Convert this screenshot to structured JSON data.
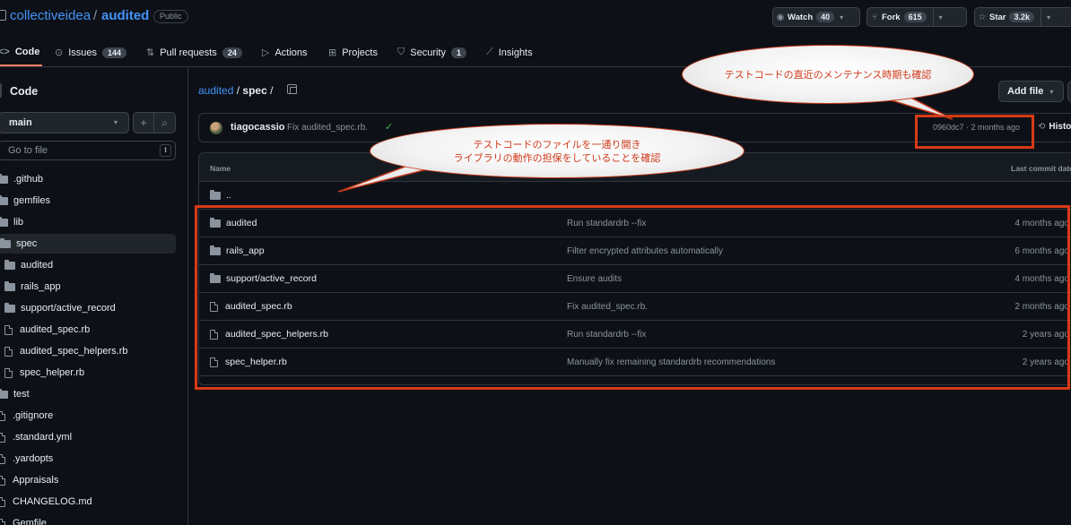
{
  "repo": {
    "owner": "collectiveidea",
    "sep": "/",
    "name": "audited",
    "visibility": "Public"
  },
  "header_buttons": {
    "watch": {
      "label": "Watch",
      "count": "40"
    },
    "fork": {
      "label": "Fork",
      "count": "615"
    },
    "star": {
      "label": "Star",
      "count": "3.2k"
    }
  },
  "tabs": [
    {
      "label": "Code"
    },
    {
      "label": "Issues",
      "count": "144"
    },
    {
      "label": "Pull requests",
      "count": "24"
    },
    {
      "label": "Actions"
    },
    {
      "label": "Projects"
    },
    {
      "label": "Security",
      "count": "1"
    },
    {
      "label": "Insights"
    }
  ],
  "sidebar": {
    "title": "Code",
    "branch": "main",
    "goto_placeholder": "Go to file",
    "goto_key": "t",
    "tree": [
      {
        "label": ".github",
        "type": "folder"
      },
      {
        "label": "gemfiles",
        "type": "folder"
      },
      {
        "label": "lib",
        "type": "folder"
      },
      {
        "label": "spec",
        "type": "folder-open"
      },
      {
        "label": "audited",
        "type": "folder"
      },
      {
        "label": "rails_app",
        "type": "folder"
      },
      {
        "label": "support/active_record",
        "type": "folder"
      },
      {
        "label": "audited_spec.rb",
        "type": "file"
      },
      {
        "label": "audited_spec_helpers.rb",
        "type": "file"
      },
      {
        "label": "spec_helper.rb",
        "type": "file"
      },
      {
        "label": "test",
        "type": "folder"
      },
      {
        "label": ".gitignore",
        "type": "file"
      },
      {
        "label": ".standard.yml",
        "type": "file"
      },
      {
        "label": ".yardopts",
        "type": "file"
      },
      {
        "label": "Appraisals",
        "type": "file"
      },
      {
        "label": "CHANGELOG.md",
        "type": "file"
      },
      {
        "label": "Gemfile",
        "type": "file"
      }
    ]
  },
  "breadcrumb": {
    "repo": "audited",
    "sep": "/",
    "current": "spec",
    "trail": "/"
  },
  "add_file": "Add file",
  "commit": {
    "author": "tiagocassio",
    "message": "Fix audited_spec.rb.",
    "meta": "0960dc7 · 2 months ago",
    "history": "History"
  },
  "table": {
    "header_name": "Name",
    "header_date": "Last commit date",
    "parent": "..",
    "rows": [
      {
        "name": "audited",
        "type": "folder",
        "message": "Run standardrb --fix",
        "date": "4 months ago"
      },
      {
        "name": "rails_app",
        "type": "folder",
        "message": "Filter encrypted attributes automatically",
        "date": "6 months ago"
      },
      {
        "name": "support/active_record",
        "type": "folder",
        "message": "Ensure audits",
        "date": "4 months ago"
      },
      {
        "name": "audited_spec.rb",
        "type": "file",
        "message": "Fix audited_spec.rb.",
        "date": "2 months ago"
      },
      {
        "name": "audited_spec_helpers.rb",
        "type": "file",
        "message": "Run standardrb --fix",
        "date": "2 years ago"
      },
      {
        "name": "spec_helper.rb",
        "type": "file",
        "message": "Manually fix remaining standardrb recommendations",
        "date": "2 years ago"
      }
    ]
  },
  "annotations": {
    "top": "テストコードの直近のメンテナンス時期も確認",
    "middle_line1": "テストコードのファイルを一通り開き",
    "middle_line2": "ライブラリの動作の担保をしていることを確認"
  },
  "colors": {
    "accent": "#4493f8",
    "annotation_red": "#d93a17",
    "background": "#0d1117"
  }
}
